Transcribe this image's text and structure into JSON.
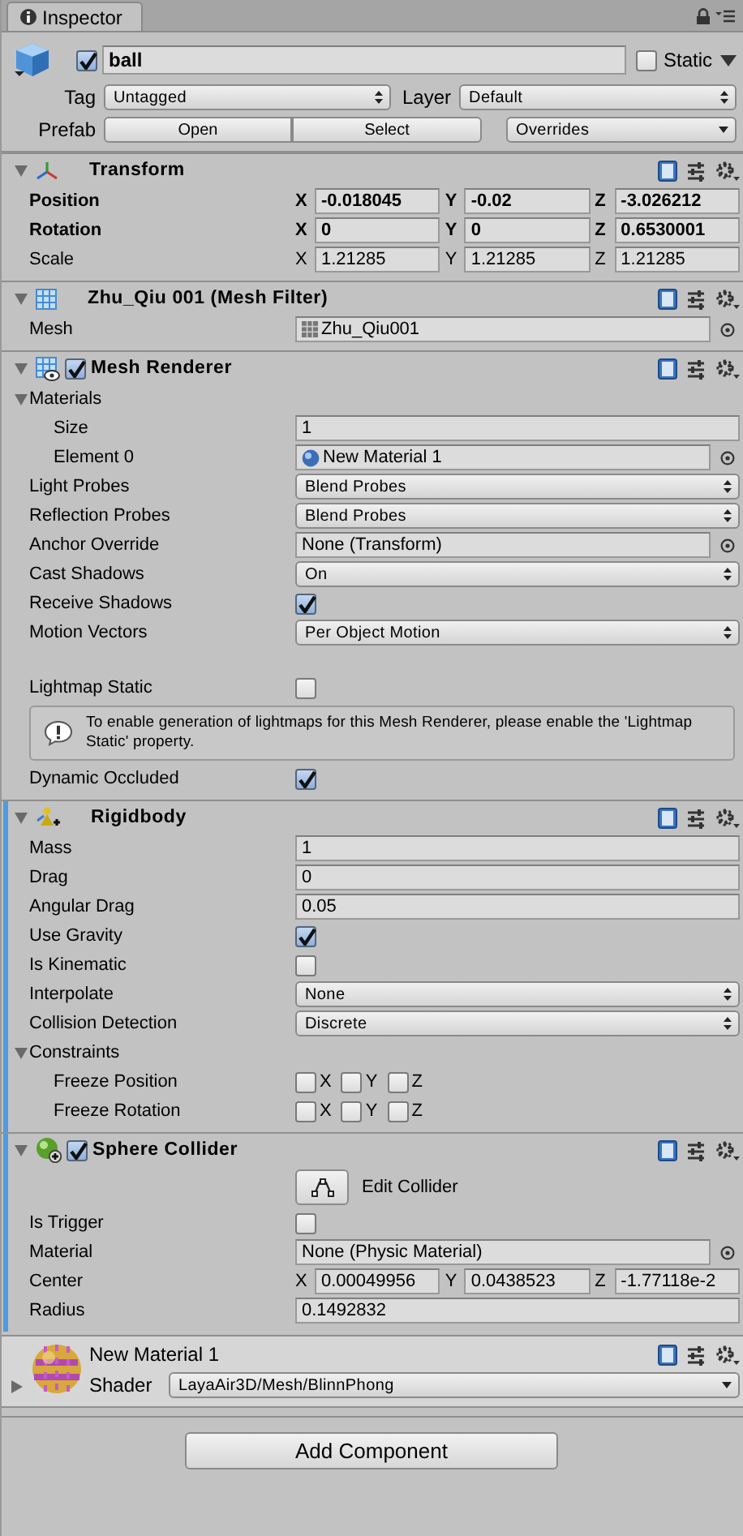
{
  "tab": {
    "label": "Inspector",
    "selected": true
  },
  "header": {
    "active": true,
    "name": "ball",
    "static": {
      "label": "Static",
      "checked": false
    },
    "tag": {
      "label": "Tag",
      "value": "Untagged"
    },
    "layer": {
      "label": "Layer",
      "value": "Default"
    },
    "prefab": {
      "label": "Prefab",
      "buttons": [
        "Open",
        "Select"
      ],
      "overrides": "Overrides"
    }
  },
  "components": [
    {
      "kind": "transform",
      "title": "Transform",
      "expanded": true,
      "added": false,
      "rows": [
        {
          "kind": "vector3",
          "label": "Position",
          "overridden": true,
          "axes": [
            {
              "label": "X",
              "value": "-0.018045"
            },
            {
              "label": "Y",
              "value": "-0.02"
            },
            {
              "label": "Z",
              "value": "-3.026212"
            }
          ]
        },
        {
          "kind": "vector3",
          "label": "Rotation",
          "overridden": true,
          "axes": [
            {
              "label": "X",
              "value": "0"
            },
            {
              "label": "Y",
              "value": "0"
            },
            {
              "label": "Z",
              "value": "0.6530001"
            }
          ]
        },
        {
          "kind": "vector3",
          "label": "Scale",
          "overridden": false,
          "axes": [
            {
              "label": "X",
              "value": "1.21285"
            },
            {
              "label": "Y",
              "value": "1.21285"
            },
            {
              "label": "Z",
              "value": "1.21285"
            }
          ]
        }
      ]
    },
    {
      "kind": "mesh_filter",
      "title": "Zhu_Qiu 001 (Mesh Filter)",
      "expanded": true,
      "added": false,
      "rows": [
        {
          "kind": "mesh_object",
          "label": "Mesh",
          "value": "Zhu_Qiu001"
        }
      ]
    },
    {
      "kind": "mesh_renderer",
      "title": "Mesh Renderer",
      "enabled": true,
      "expanded": true,
      "added": false,
      "rows": [
        {
          "kind": "foldout",
          "label": "Materials",
          "expanded": true,
          "children": [
            {
              "kind": "float",
              "label": "Size",
              "value": "1"
            },
            {
              "kind": "material_object",
              "label": "Element 0",
              "value": "New Material 1"
            }
          ]
        },
        {
          "kind": "dropdown",
          "label": "Light Probes",
          "value": "Blend Probes"
        },
        {
          "kind": "dropdown",
          "label": "Reflection Probes",
          "value": "Blend Probes"
        },
        {
          "kind": "object",
          "label": "Anchor Override",
          "value": "None (Transform)"
        },
        {
          "kind": "dropdown",
          "label": "Cast Shadows",
          "value": "On"
        },
        {
          "kind": "toggle",
          "label": "Receive Shadows",
          "checked": true
        },
        {
          "kind": "dropdown",
          "label": "Motion Vectors",
          "value": "Per Object Motion"
        },
        {
          "kind": "toggle",
          "label": "Lightmap Static",
          "checked": false,
          "separated": true
        },
        {
          "kind": "help",
          "text": "To enable generation of lightmaps for this Mesh Renderer, please enable the 'Lightmap Static' property."
        },
        {
          "kind": "toggle",
          "label": "Dynamic Occluded",
          "checked": true
        }
      ]
    },
    {
      "kind": "rigidbody",
      "title": "Rigidbody",
      "expanded": true,
      "added": true,
      "rows": [
        {
          "kind": "float",
          "label": "Mass",
          "value": "1"
        },
        {
          "kind": "float",
          "label": "Drag",
          "value": "0"
        },
        {
          "kind": "float",
          "label": "Angular Drag",
          "value": "0.05"
        },
        {
          "kind": "toggle",
          "label": "Use Gravity",
          "checked": true
        },
        {
          "kind": "toggle",
          "label": "Is Kinematic",
          "checked": false
        },
        {
          "kind": "dropdown",
          "label": "Interpolate",
          "value": "None"
        },
        {
          "kind": "dropdown",
          "label": "Collision Detection",
          "value": "Discrete"
        },
        {
          "kind": "foldout",
          "label": "Constraints",
          "expanded": true,
          "children": [
            {
              "kind": "axis_toggles",
              "label": "Freeze Position",
              "axes": [
                {
                  "label": "X",
                  "checked": false
                },
                {
                  "label": "Y",
                  "checked": false
                },
                {
                  "label": "Z",
                  "checked": false
                }
              ]
            },
            {
              "kind": "axis_toggles",
              "label": "Freeze Rotation",
              "axes": [
                {
                  "label": "X",
                  "checked": false
                },
                {
                  "label": "Y",
                  "checked": false
                },
                {
                  "label": "Z",
                  "checked": false
                }
              ]
            }
          ]
        }
      ]
    },
    {
      "kind": "sphere_collider",
      "title": "Sphere Collider",
      "enabled": true,
      "expanded": true,
      "added": true,
      "rows": [
        {
          "kind": "edit_button",
          "label": "Edit Collider"
        },
        {
          "kind": "toggle",
          "label": "Is Trigger",
          "checked": false
        },
        {
          "kind": "object",
          "label": "Material",
          "value": "None (Physic Material)"
        },
        {
          "kind": "vector3",
          "label": "Center",
          "overridden": false,
          "axes": [
            {
              "label": "X",
              "value": "0.00049956"
            },
            {
              "label": "Y",
              "value": "0.0438523"
            },
            {
              "label": "Z",
              "value": "-1.77118e-2"
            }
          ]
        },
        {
          "kind": "float",
          "label": "Radius",
          "value": "0.1492832"
        }
      ]
    }
  ],
  "material": {
    "name": "New Material 1",
    "expanded": false,
    "shader_label": "Shader",
    "shader": "LayaAir3D/Mesh/BlinnPhong"
  },
  "add_component": "Add Component"
}
